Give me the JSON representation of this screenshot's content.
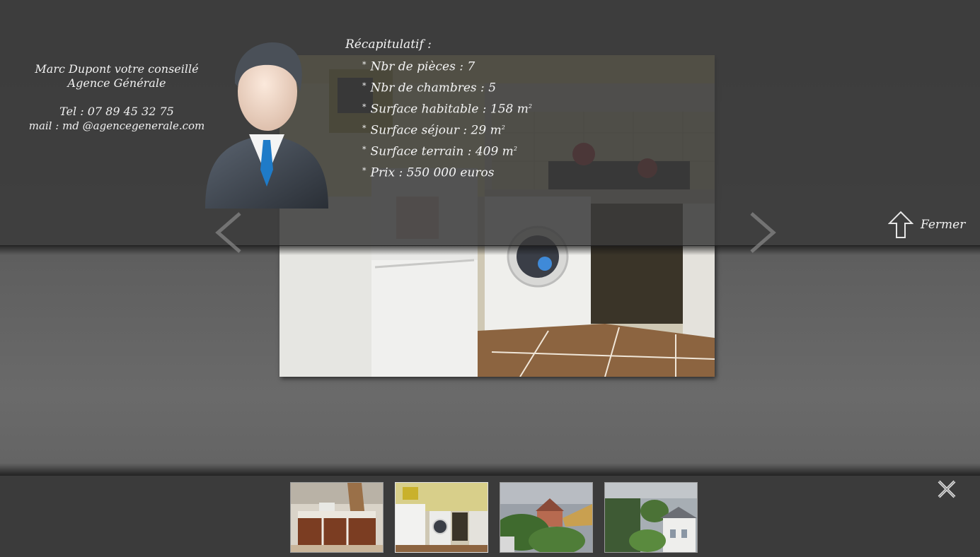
{
  "contact": {
    "line1": "Marc Dupont votre conseillé",
    "line2": "Agence Générale",
    "phone": "Tel : 07 89  45 32 75",
    "email": "mail : md @agencegenerale.com"
  },
  "recap": {
    "title": "Récapitulatif :",
    "bullet": "*",
    "items": [
      {
        "text": "Nbr de pièces : 7",
        "sup": ""
      },
      {
        "text": "Nbr de chambres : 5",
        "sup": ""
      },
      {
        "text": "Surface habitable : 158 m",
        "sup": "2"
      },
      {
        "text": "Surface séjour : 29 m",
        "sup": "2"
      },
      {
        "text": "Surface terrain : 409 m",
        "sup": "2"
      },
      {
        "text": "Prix : 550 000 euros",
        "sup": ""
      }
    ]
  },
  "nav": {
    "prev_icon": "chevron-left-icon",
    "next_icon": "chevron-right-icon",
    "close_label": "Fermer",
    "close_icon": "arrow-up-icon",
    "dismiss_icon": "close-x-icon"
  },
  "main_photo": {
    "subject": "kitchen with refrigerator and washing machine"
  },
  "thumbnails": [
    {
      "subject": "kitchen with wooden cabinets",
      "active": false
    },
    {
      "subject": "kitchen with refrigerator and washing machine",
      "active": true
    },
    {
      "subject": "rooftops and trees",
      "active": false
    },
    {
      "subject": "ivy covered house and white house",
      "active": false
    }
  ],
  "colors": {
    "top_band": "#3a3a3a",
    "bottom_band": "#3b3b3b",
    "text": "#f2f2f2"
  }
}
